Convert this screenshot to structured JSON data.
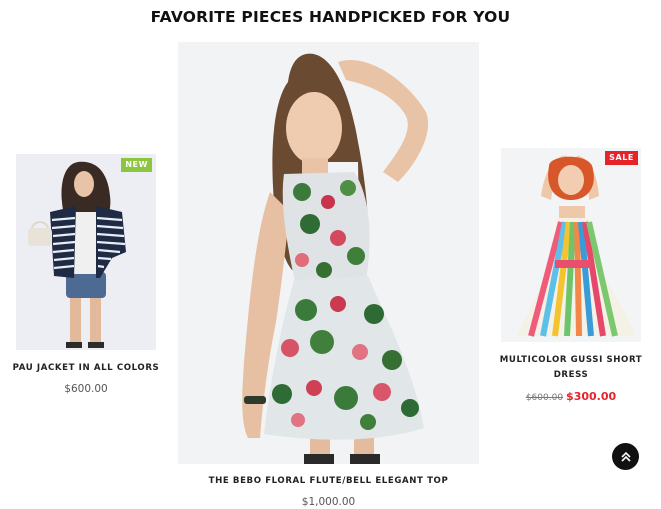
{
  "section": {
    "title": "FAVORITE PIECES HANDPICKED FOR YOU"
  },
  "products": [
    {
      "name": "PAU JACKET IN ALL COLORS",
      "price": "$600.00",
      "badge": "NEW"
    },
    {
      "name": "THE BEBO FLORAL FLUTE/BELL ELEGANT TOP",
      "price": "$1,000.00"
    },
    {
      "name": "MULTICOLOR GUSSI SHORT DRESS",
      "old_price": "$600.00",
      "sale_price": "$300.00",
      "badge": "SALE"
    }
  ],
  "colors": {
    "new_badge": "#8cc63f",
    "sale_badge": "#e4232b",
    "back_to_top": "#111111"
  },
  "icons": {
    "back_to_top": "double-chevron-up-icon"
  }
}
